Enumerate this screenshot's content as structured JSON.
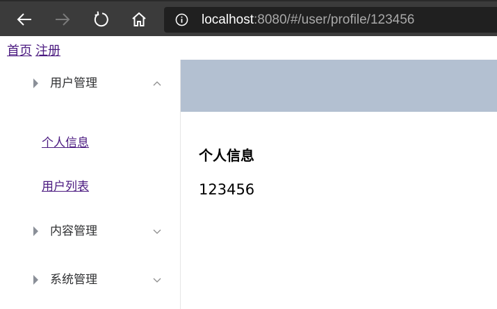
{
  "browser": {
    "url_host": "localhost",
    "url_rest": ":8080/#/user/profile/123456",
    "icons": [
      "back-arrow-icon",
      "forward-arrow-icon",
      "refresh-icon",
      "home-icon",
      "info-icon"
    ],
    "colors": {
      "chrome": "#3b3b3b",
      "address_bar": "#202020"
    }
  },
  "top_links": [
    {
      "label": "首页"
    },
    {
      "label": "注册"
    }
  ],
  "sidebar": {
    "menus": [
      {
        "label": "用户管理",
        "expanded": true,
        "items": [
          {
            "label": "个人信息"
          },
          {
            "label": "用户列表"
          }
        ]
      },
      {
        "label": "内容管理",
        "expanded": false
      },
      {
        "label": "系统管理",
        "expanded": false
      }
    ]
  },
  "main": {
    "heading": "个人信息",
    "user_id": "123456"
  },
  "colors": {
    "header_bar": "#b3c0d1",
    "link": "#4b1a80"
  }
}
